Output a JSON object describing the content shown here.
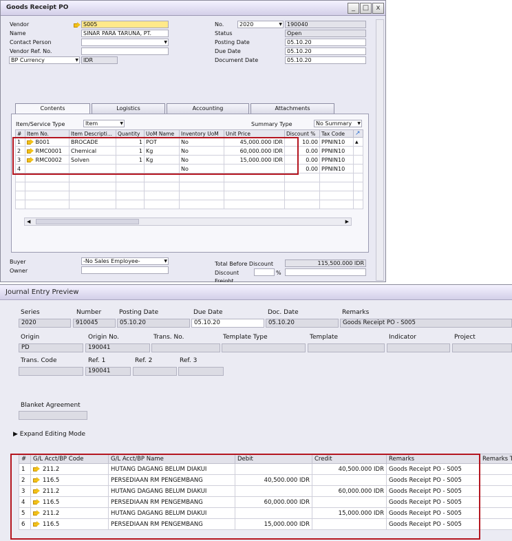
{
  "gr": {
    "title": "Goods Receipt PO",
    "window_buttons": [
      "_",
      "□",
      "x"
    ],
    "vendor_label": "Vendor",
    "vendor": "S005",
    "name_label": "Name",
    "name": "SINAR PARA TARUNA, PT.",
    "contact_label": "Contact Person",
    "contact": "",
    "vendor_ref_label": "Vendor Ref. No.",
    "vendor_ref": "",
    "currency_type": "BP Currency",
    "currency": "IDR",
    "no_label": "No.",
    "no_series": "2020",
    "no_value": "190040",
    "status_label": "Status",
    "status": "Open",
    "posting_label": "Posting Date",
    "posting": "05.10.20",
    "due_label": "Due Date",
    "due": "05.10.20",
    "doc_date_label": "Document Date",
    "doc_date": "05.10.20",
    "tabs": [
      "Contents",
      "Logistics",
      "Accounting",
      "Attachments"
    ],
    "item_type_label": "Item/Service Type",
    "item_type": "Item",
    "summary_label": "Summary Type",
    "summary": "No Summary",
    "columns": [
      "#",
      "Item No.",
      "Item Descripti...",
      "Quantity",
      "UoM Name",
      "Inventory UoM",
      "Unit Price",
      "Discount %",
      "Tax Code"
    ],
    "rows": [
      {
        "n": "1",
        "item": "B001",
        "desc": "BROCADE",
        "qty": "1",
        "uom": "POT",
        "inv": "No",
        "price": "45,000.000 IDR",
        "disc": "10.00",
        "tax": "PPNIN10"
      },
      {
        "n": "2",
        "item": "RMC0001",
        "desc": "Chemical",
        "qty": "1",
        "uom": "Kg",
        "inv": "No",
        "price": "60,000.000 IDR",
        "disc": "0.00",
        "tax": "PPNIN10"
      },
      {
        "n": "3",
        "item": "RMC0002",
        "desc": "Solven",
        "qty": "1",
        "uom": "Kg",
        "inv": "No",
        "price": "15,000.000 IDR",
        "disc": "0.00",
        "tax": "PPNIN10"
      },
      {
        "n": "4",
        "item": "",
        "desc": "",
        "qty": "",
        "uom": "",
        "inv": "No",
        "price": "",
        "disc": "0.00",
        "tax": "PPNIN10"
      }
    ],
    "buyer_label": "Buyer",
    "buyer": "-No Sales Employee-",
    "owner_label": "Owner",
    "owner": "",
    "total_before_label": "Total Before Discount",
    "total_before": "115,500.000 IDR",
    "discount_label": "Discount",
    "percent": "%",
    "freight_label": "Freight"
  },
  "je": {
    "title": "Journal Entry Preview",
    "series_label": "Series",
    "series": "2020",
    "number_label": "Number",
    "number": "910045",
    "posting_label": "Posting Date",
    "posting": "05.10.20",
    "due_label": "Due Date",
    "due": "05.10.20",
    "doc_label": "Doc. Date",
    "doc": "05.10.20",
    "remarks_label": "Remarks",
    "remarks": "Goods Receipt PO - S005",
    "origin_label": "Origin",
    "origin": "PD",
    "origin_no_label": "Origin No.",
    "origin_no": "190041",
    "trans_no_label": "Trans. No.",
    "template_type_label": "Template Type",
    "template_label": "Template",
    "indicator_label": "Indicator",
    "project_label": "Project",
    "trans_code_label": "Trans. Code",
    "ref1_label": "Ref. 1",
    "ref1": "190041",
    "ref2_label": "Ref. 2",
    "ref3_label": "Ref. 3",
    "blanket_label": "Blanket Agreement",
    "expand_label": "Expand Editing Mode",
    "columns": [
      "#",
      "G/L Acct/BP Code",
      "G/L Acct/BP Name",
      "Debit",
      "Credit",
      "Remarks",
      "Remarks T"
    ],
    "rows": [
      {
        "n": "1",
        "code": "211.2",
        "name": "HUTANG DAGANG BELUM DIAKUI",
        "debit": "",
        "credit": "40,500.000 IDR",
        "rem": "Goods Receipt PO - S005"
      },
      {
        "n": "2",
        "code": "116.5",
        "name": "PERSEDIAAN RM PENGEMBANG",
        "debit": "40,500.000 IDR",
        "credit": "",
        "rem": "Goods Receipt PO - S005"
      },
      {
        "n": "3",
        "code": "211.2",
        "name": "HUTANG DAGANG BELUM DIAKUI",
        "debit": "",
        "credit": "60,000.000 IDR",
        "rem": "Goods Receipt PO - S005"
      },
      {
        "n": "4",
        "code": "116.5",
        "name": "PERSEDIAAN RM PENGEMBANG",
        "debit": "60,000.000 IDR",
        "credit": "",
        "rem": "Goods Receipt PO - S005"
      },
      {
        "n": "5",
        "code": "211.2",
        "name": "HUTANG DAGANG BELUM DIAKUI",
        "debit": "",
        "credit": "15,000.000 IDR",
        "rem": "Goods Receipt PO - S005"
      },
      {
        "n": "6",
        "code": "116.5",
        "name": "PERSEDIAAN RM PENGEMBANG",
        "debit": "15,000.000 IDR",
        "credit": "",
        "rem": "Goods Receipt PO - S005"
      }
    ]
  }
}
